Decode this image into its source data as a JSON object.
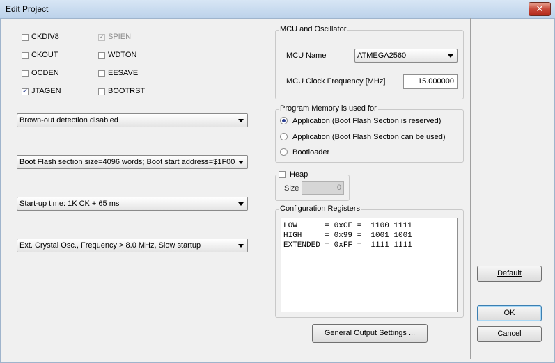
{
  "window": {
    "title": "Edit Project",
    "close_glyph": "✕"
  },
  "fuses": {
    "left": [
      {
        "label": "CKDIV8",
        "checked": false
      },
      {
        "label": "CKOUT",
        "checked": false
      },
      {
        "label": "OCDEN",
        "checked": false
      },
      {
        "label": "JTAGEN",
        "checked": true
      }
    ],
    "right": [
      {
        "label": "SPIEN",
        "checked": true,
        "disabled": true
      },
      {
        "label": "WDTON",
        "checked": false
      },
      {
        "label": "EESAVE",
        "checked": false
      },
      {
        "label": "BOOTRST",
        "checked": false
      }
    ]
  },
  "dropdowns": {
    "brownout": "Brown-out detection disabled",
    "bootflash": "Boot Flash section size=4096 words; Boot start address=$1F000",
    "startup": "Start-up time: 1K CK + 65 ms",
    "oscillator": "Ext. Crystal Osc., Frequency > 8.0 MHz, Slow startup"
  },
  "mcu": {
    "group_title": "MCU and Oscillator",
    "name_label": "MCU Name",
    "name_value": "ATMEGA2560",
    "freq_label": "MCU Clock Frequency [MHz]",
    "freq_value": "15.000000"
  },
  "program_memory": {
    "group_title": "Program Memory is used for",
    "options": [
      {
        "label": "Application (Boot Flash Section is reserved)",
        "selected": true
      },
      {
        "label": "Application (Boot Flash Section can be used)",
        "selected": false
      },
      {
        "label": "Bootloader",
        "selected": false
      }
    ]
  },
  "heap": {
    "label": "Heap",
    "checked": false,
    "size_label": "Size",
    "size_value": "0"
  },
  "config_registers": {
    "group_title": "Configuration Registers",
    "lines": [
      "LOW      = 0xCF =  1100 1111",
      "HIGH     = 0x99 =  1001 1001",
      "EXTENDED = 0xFF =  1111 1111"
    ]
  },
  "buttons": {
    "general_output": "General Output Settings ...",
    "default_label": "Default",
    "ok_label": "OK",
    "cancel_label": "Cancel"
  }
}
